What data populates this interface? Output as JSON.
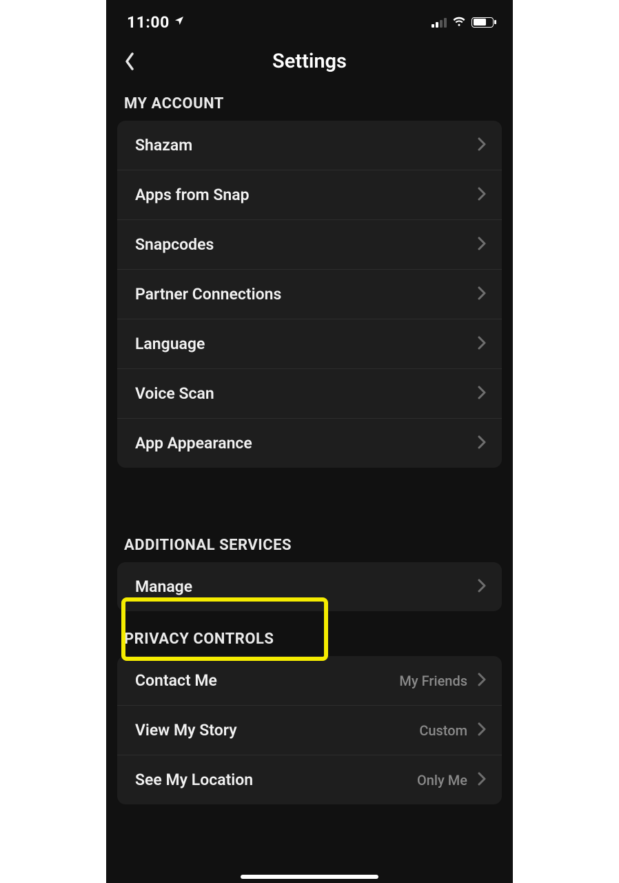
{
  "status": {
    "time": "11:00"
  },
  "header": {
    "title": "Settings"
  },
  "sections": {
    "my_account": {
      "title": "MY ACCOUNT",
      "items": [
        {
          "label": "Shazam"
        },
        {
          "label": "Apps from Snap"
        },
        {
          "label": "Snapcodes"
        },
        {
          "label": "Partner Connections"
        },
        {
          "label": "Language"
        },
        {
          "label": "Voice Scan"
        },
        {
          "label": "App Appearance"
        }
      ]
    },
    "additional_services": {
      "title": "ADDITIONAL SERVICES",
      "items": [
        {
          "label": "Manage"
        }
      ]
    },
    "privacy_controls": {
      "title": "PRIVACY CONTROLS",
      "items": [
        {
          "label": "Contact Me",
          "value": "My Friends"
        },
        {
          "label": "View My Story",
          "value": "Custom"
        },
        {
          "label": "See My Location",
          "value": "Only Me"
        }
      ]
    }
  }
}
